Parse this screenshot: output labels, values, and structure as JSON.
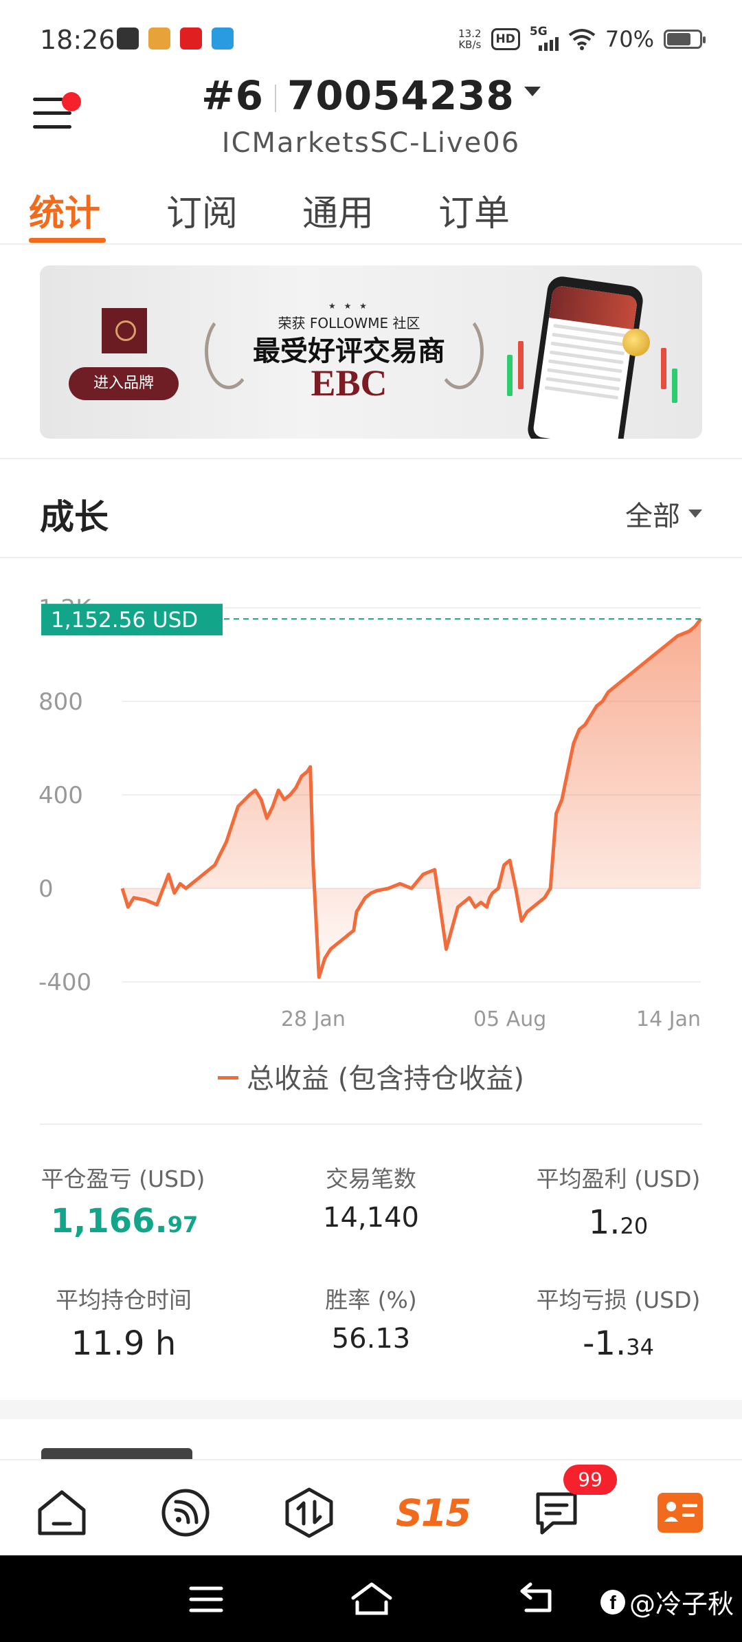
{
  "status_bar": {
    "time": "18:26",
    "net_speed_value": "13.2",
    "net_speed_unit": "KB/s",
    "hd_label": "HD",
    "network_label": "5G",
    "battery_percent": "70%",
    "battery_level": 0.7,
    "left_icons": [
      "app-icon-1",
      "app-icon-2",
      "app-icon-3",
      "app-icon-4"
    ]
  },
  "header": {
    "account_rank": "#6",
    "account_number": "70054238",
    "server": "ICMarketsSC-Live06"
  },
  "tabs": [
    {
      "label": "统计",
      "active": true
    },
    {
      "label": "订阅",
      "active": false
    },
    {
      "label": "通用",
      "active": false
    },
    {
      "label": "订单",
      "active": false
    }
  ],
  "banner": {
    "stars": "★ ★ ★",
    "subtitle": "荣获 FOLLOWME 社区",
    "headline": "最受好评交易商",
    "brand": "EBC",
    "cta": "进入品牌"
  },
  "growth": {
    "title": "成长",
    "filter": "全部",
    "current_value_label": "1,152.56 USD",
    "legend": "总收益 (包含持仓收益)"
  },
  "chart_data": {
    "type": "area",
    "title": "",
    "xlabel": "",
    "ylabel": "",
    "y_ticks": [
      "1.2K",
      "800",
      "400",
      "0",
      "-400"
    ],
    "y_tick_values": [
      1200,
      800,
      400,
      0,
      -400
    ],
    "x_tick_labels": [
      "28 Jan",
      "05 Aug",
      "14 Jan"
    ],
    "x_tick_positions": [
      0.33,
      0.67,
      1.0
    ],
    "ylim": [
      -400,
      1200
    ],
    "reference_line": 1152.56,
    "grid": true,
    "series": [
      {
        "name": "总收益 (包含持仓收益)",
        "color": "#f26b3a",
        "x": [
          0,
          0.01,
          0.02,
          0.04,
          0.06,
          0.08,
          0.09,
          0.1,
          0.11,
          0.12,
          0.13,
          0.14,
          0.15,
          0.16,
          0.18,
          0.2,
          0.22,
          0.23,
          0.24,
          0.25,
          0.26,
          0.27,
          0.28,
          0.29,
          0.3,
          0.31,
          0.32,
          0.325,
          0.33,
          0.34,
          0.35,
          0.36,
          0.37,
          0.38,
          0.39,
          0.4,
          0.405,
          0.41,
          0.415,
          0.42,
          0.43,
          0.44,
          0.46,
          0.48,
          0.5,
          0.52,
          0.54,
          0.56,
          0.58,
          0.59,
          0.6,
          0.61,
          0.62,
          0.63,
          0.635,
          0.64,
          0.65,
          0.66,
          0.67,
          0.68,
          0.69,
          0.7,
          0.71,
          0.72,
          0.73,
          0.735,
          0.74,
          0.75,
          0.76,
          0.77,
          0.78,
          0.79,
          0.8,
          0.81,
          0.82,
          0.83,
          0.84,
          0.85,
          0.86,
          0.88,
          0.9,
          0.92,
          0.94,
          0.96,
          0.98,
          0.99,
          1.0
        ],
        "values": [
          0,
          -80,
          -40,
          -50,
          -70,
          60,
          -20,
          20,
          0,
          20,
          40,
          60,
          80,
          100,
          200,
          350,
          400,
          420,
          380,
          300,
          350,
          420,
          380,
          400,
          430,
          480,
          500,
          520,
          100,
          -380,
          -300,
          -260,
          -240,
          -220,
          -200,
          -180,
          -100,
          -80,
          -60,
          -40,
          -20,
          -10,
          0,
          20,
          0,
          60,
          80,
          -260,
          -80,
          -60,
          -40,
          -80,
          -60,
          -80,
          -40,
          -20,
          0,
          100,
          120,
          0,
          -140,
          -100,
          -80,
          -60,
          -40,
          -20,
          0,
          320,
          380,
          500,
          620,
          680,
          700,
          740,
          780,
          800,
          840,
          860,
          880,
          920,
          960,
          1000,
          1040,
          1080,
          1100,
          1120,
          1152.56
        ]
      }
    ]
  },
  "stats": [
    {
      "label": "平仓盈亏 (USD)",
      "value_int": "1,166.",
      "value_dec": "97",
      "highlight": true
    },
    {
      "label": "交易笔数",
      "value_int": "14,140",
      "value_dec": "",
      "highlight": false
    },
    {
      "label": "平均盈利 (USD)",
      "value_int": "1.",
      "value_dec": "20",
      "highlight": false
    },
    {
      "label": "平均持仓时间",
      "value_int": "11.9 h",
      "value_dec": "",
      "highlight": false
    },
    {
      "label": "胜率 (%)",
      "value_int": "56.13",
      "value_dec": "",
      "highlight": false
    },
    {
      "label": "平均亏损 (USD)",
      "value_int": "-1.",
      "value_dec": "34",
      "highlight": false
    }
  ],
  "bottom_nav": {
    "items": [
      "home-icon",
      "feed-icon",
      "trade-icon",
      "brand-icon",
      "messages-icon",
      "profile-icon"
    ],
    "brand_label": "S15",
    "messages_badge": "99"
  },
  "watermark": {
    "logo_letter": "f",
    "text": "@冷子秋"
  },
  "colors": {
    "accent": "#f26b1d",
    "positive": "#12a58a",
    "chart_line": "#f26b3a",
    "badge": "#f5222d"
  }
}
